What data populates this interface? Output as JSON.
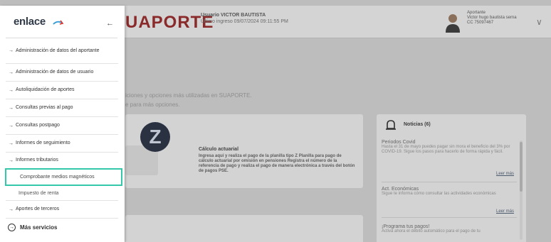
{
  "header": {
    "brand": "UAPORTE",
    "user_line": "Usuario VICTOR BAUTISTA",
    "last_login": "Último ingreso 09/07/2024 09:11:55 PM",
    "profile": {
      "role": "Aportante",
      "name": "Victor hugo bautista serna",
      "id": "CC 75097467"
    }
  },
  "intro": {
    "line1": "iciones y opciones más utilizadas en SUAPORTE.",
    "line2": "e para más opciones."
  },
  "card": {
    "title": "Cálculo actuarial",
    "body": "Ingresa aquí y realiza el pago de la planilla tipo Z Planilla para pago de cálculo actuarial por omisión en pensiones Registra el número de la referencia de pago y realiza el pago de manera electrónica a través del botón de pagos PSE."
  },
  "news": {
    "title": "Noticias (6)",
    "items": [
      {
        "head": "Periodos Covid",
        "text": "Hasta el 31 de mayo puedes pagar sin mora el beneficio del 3% por COVID-19. Sigue los pasos para hacerlo de forma rápida y fácil.",
        "link": "Leer más"
      },
      {
        "head": "Act. Económicas",
        "text": "Sigue te informa cómo consultar las actividades económicas",
        "link": "Leer más"
      },
      {
        "head": "¡Programa tus pagos!",
        "text": "Activa ahora el débito automático para el pago de tu"
      }
    ]
  },
  "sidebar": {
    "logo": "enlace",
    "back_icon": "arrow-left-icon",
    "items": [
      {
        "label": "Administración de datos del aportante"
      },
      {
        "label": "Administración de datos de usuario"
      },
      {
        "label": "Autoliquidación de aportes"
      },
      {
        "label": "Consultas previas al pago"
      },
      {
        "label": "Consultas postpago"
      },
      {
        "label": "Informes de seguimiento"
      },
      {
        "label": "Informes tributarios"
      }
    ],
    "subitems": [
      {
        "label": "Comprobante medios magnéticos",
        "active": true
      },
      {
        "label": "Impuesto de renta",
        "active": false
      }
    ],
    "after": {
      "label": "Aportes de terceros"
    },
    "more": {
      "label": "Más servicios"
    },
    "accent": "#35c7aa"
  }
}
